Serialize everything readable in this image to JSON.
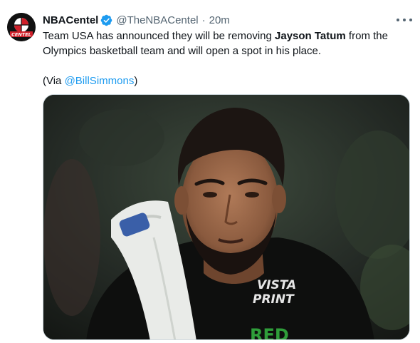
{
  "tweet": {
    "author": {
      "name": "NBACentel",
      "handle": "@TheNBACentel",
      "avatar_text": "CENTEL",
      "verified_icon": "verified-badge-icon"
    },
    "separator": "·",
    "time": "20m",
    "more_icon": "more-options-icon",
    "text": {
      "before": "Team USA has announced they will be removing ",
      "bold": "Jayson Tatum",
      "after": " from the Olympics basketball team and will open a spot in his place."
    },
    "via": {
      "prefix": "(Via ",
      "mention": "@BillSimmons",
      "suffix": ")"
    },
    "media": {
      "jersey_text_line1": "VISTA",
      "jersey_text_line2": "PRINT",
      "jersey_partial": "RED"
    }
  },
  "colors": {
    "text": "#0f1419",
    "secondary": "#536471",
    "link": "#1d9bf0",
    "verified": "#1d9bf0",
    "avatar_red": "#d0202a"
  }
}
